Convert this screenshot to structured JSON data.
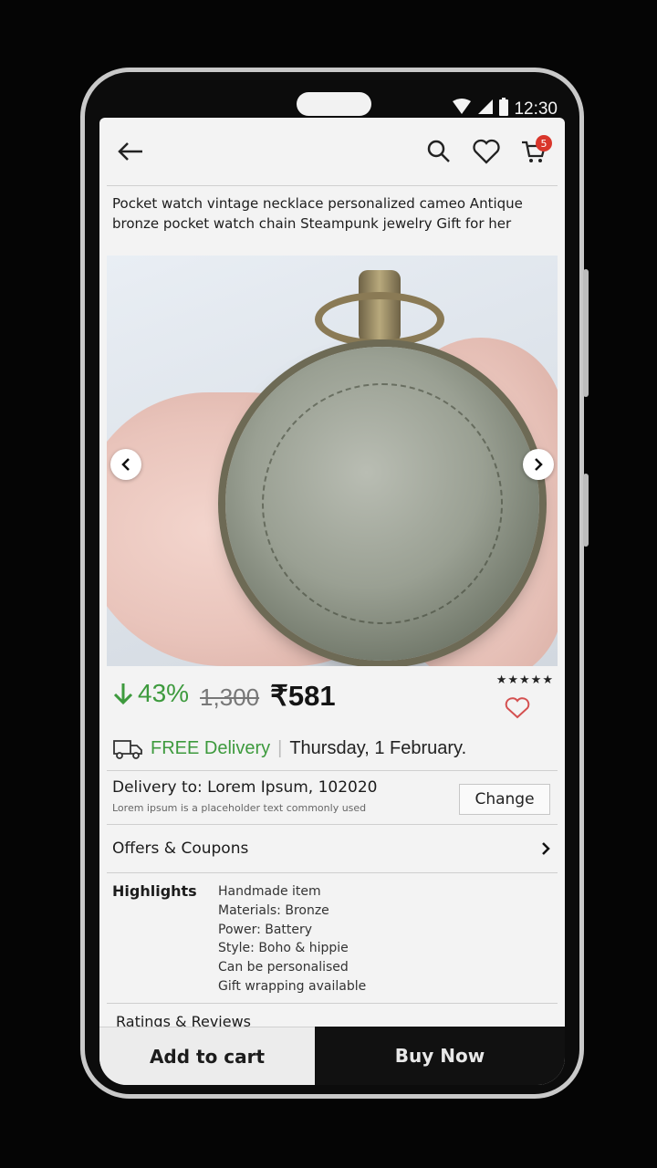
{
  "status_bar": {
    "time": "12:30"
  },
  "header": {
    "cart_count": "5"
  },
  "product": {
    "title": "Pocket watch vintage necklace personalized cameo Antique bronze pocket watch chain Steampunk jewelry Gift for her",
    "discount": "43%",
    "mrp": "1,300",
    "price": "₹581",
    "rating_stars": "★★★★★"
  },
  "delivery": {
    "free_label": "FREE Delivery",
    "separator": "|",
    "date": "Thursday, 1 February."
  },
  "address": {
    "line": "Delivery to: Lorem Ipsum, 102020",
    "sub": "Lorem ipsum is a placeholder text commonly used",
    "change_label": "Change"
  },
  "offers": {
    "label": "Offers & Coupons"
  },
  "highlights": {
    "label": "Highlights",
    "items": [
      "Handmade item",
      "Materials: Bronze",
      "Power: Battery",
      "Style: Boho & hippie",
      "Can be personalised",
      "Gift wrapping available"
    ]
  },
  "ratings": {
    "label": "Ratings & Reviews"
  },
  "actions": {
    "add_to_cart": "Add to cart",
    "buy_now": "Buy Now"
  },
  "colors": {
    "discount_green": "#3d9a3d",
    "badge_red": "#d9362b",
    "buy_bg": "#111111"
  }
}
